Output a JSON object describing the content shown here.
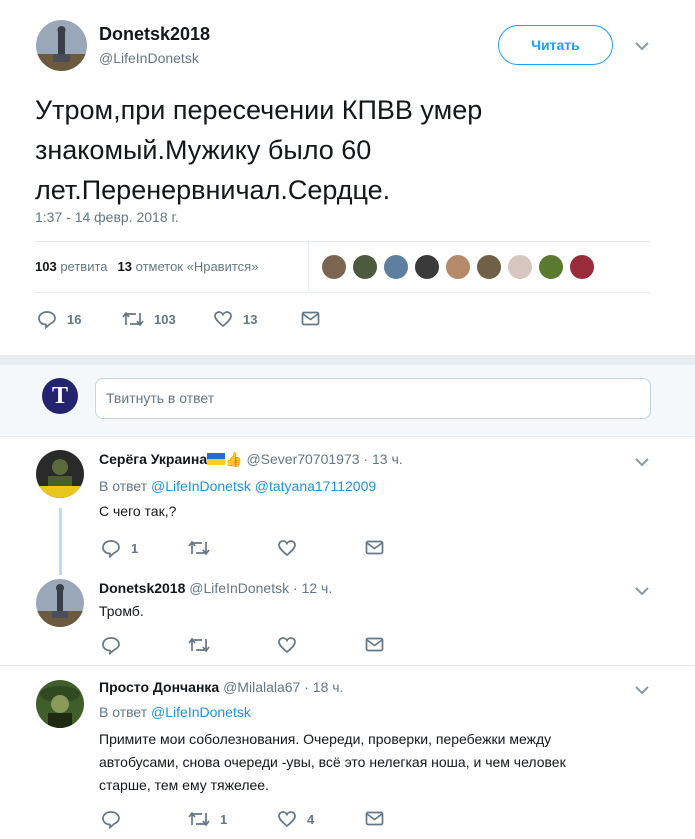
{
  "main_tweet": {
    "author_name": "Donetsk2018",
    "author_handle": "@LifeInDonetsk",
    "follow_label": "Читать",
    "text": "Утром,при пересечении КПВВ умер знакомый.Мужику было 60 лет.Перенервничал.Сердце.",
    "timestamp": "1:37 - 14 февр. 2018 г.",
    "retweets_count": "103",
    "retweets_label": "ретвита",
    "likes_count": "13",
    "likes_label": "отметок «Нравится»",
    "actions": {
      "replies": "16",
      "retweets": "103",
      "likes": "13"
    }
  },
  "reply_box": {
    "placeholder": "Твитнуть в ответ",
    "avatar_letter": "T"
  },
  "replies": [
    {
      "author_name": "Серёга Украина",
      "author_handle": "@Sever70701973",
      "time": "13 ч.",
      "replying_label": "В ответ",
      "replying_to": [
        "@LifeInDonetsk",
        "@tatyana17112009"
      ],
      "text": "С чего так,?",
      "actions": {
        "replies": "1",
        "retweets": "",
        "likes": ""
      }
    },
    {
      "author_name": "Donetsk2018",
      "author_handle": "@LifeInDonetsk",
      "time": "12 ч.",
      "text": "Тромб.",
      "actions": {
        "replies": "",
        "retweets": "",
        "likes": ""
      }
    },
    {
      "author_name": "Просто Дончанка",
      "author_handle": "@Milalala67",
      "time": "18 ч.",
      "replying_label": "В ответ",
      "replying_to": [
        "@LifeInDonetsk"
      ],
      "text": "Примите мои соболезнования. Очереди, проверки, перебежки между автобусами, снова очереди -увы, всё это нелегкая ноша, и чем человек старше, тем ему тяжелее.",
      "actions": {
        "replies": "",
        "retweets": "1",
        "likes": "4"
      }
    }
  ],
  "dot": "·",
  "colors": {
    "accent": "#1da1f2",
    "link": "#1b95e0",
    "muted": "#657786",
    "border": "#e6ecf0"
  }
}
